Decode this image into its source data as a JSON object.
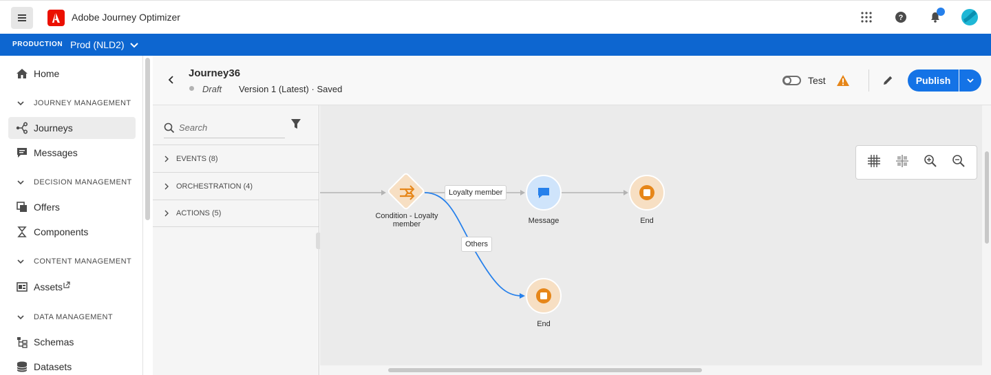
{
  "app": {
    "name": "Adobe Journey Optimizer"
  },
  "env": {
    "label": "PRODUCTION",
    "sandbox": "Prod (NLD2)"
  },
  "nav": {
    "home": "Home",
    "sections": {
      "journey": "JOURNEY MANAGEMENT",
      "decision": "DECISION MANAGEMENT",
      "content": "CONTENT MANAGEMENT",
      "data": "DATA MANAGEMENT"
    },
    "journeys": "Journeys",
    "messages": "Messages",
    "offers": "Offers",
    "components": "Components",
    "assets": "Assets",
    "schemas": "Schemas",
    "datasets": "Datasets"
  },
  "journey": {
    "title": "Journey36",
    "status": "Draft",
    "version": "Version 1 (Latest) · Saved",
    "test_label": "Test",
    "test_enabled": false,
    "publish_label": "Publish"
  },
  "palette": {
    "search_placeholder": "Search",
    "categories": [
      {
        "label": "EVENTS (8)"
      },
      {
        "label": "ORCHESTRATION (4)"
      },
      {
        "label": "ACTIONS (5)"
      }
    ]
  },
  "canvas": {
    "nodes": {
      "condition": "Condition - Loyalty member",
      "message": "Message",
      "end_top": "End",
      "end_bottom": "End"
    },
    "edges": {
      "loyalty": "Loyalty member",
      "others": "Others"
    }
  },
  "colors": {
    "accent": "#1473e6",
    "env_bar": "#0d66d0",
    "adobe_red": "#eb1000",
    "orchestration_orange": "#e68619",
    "action_blue": "#2680eb",
    "warning": "#e68619"
  },
  "icons": {
    "menu": "hamburger-icon",
    "apps": "app-grid-icon",
    "help": "help-icon",
    "notifications": "bell-icon",
    "avatar": "avatar-icon"
  }
}
